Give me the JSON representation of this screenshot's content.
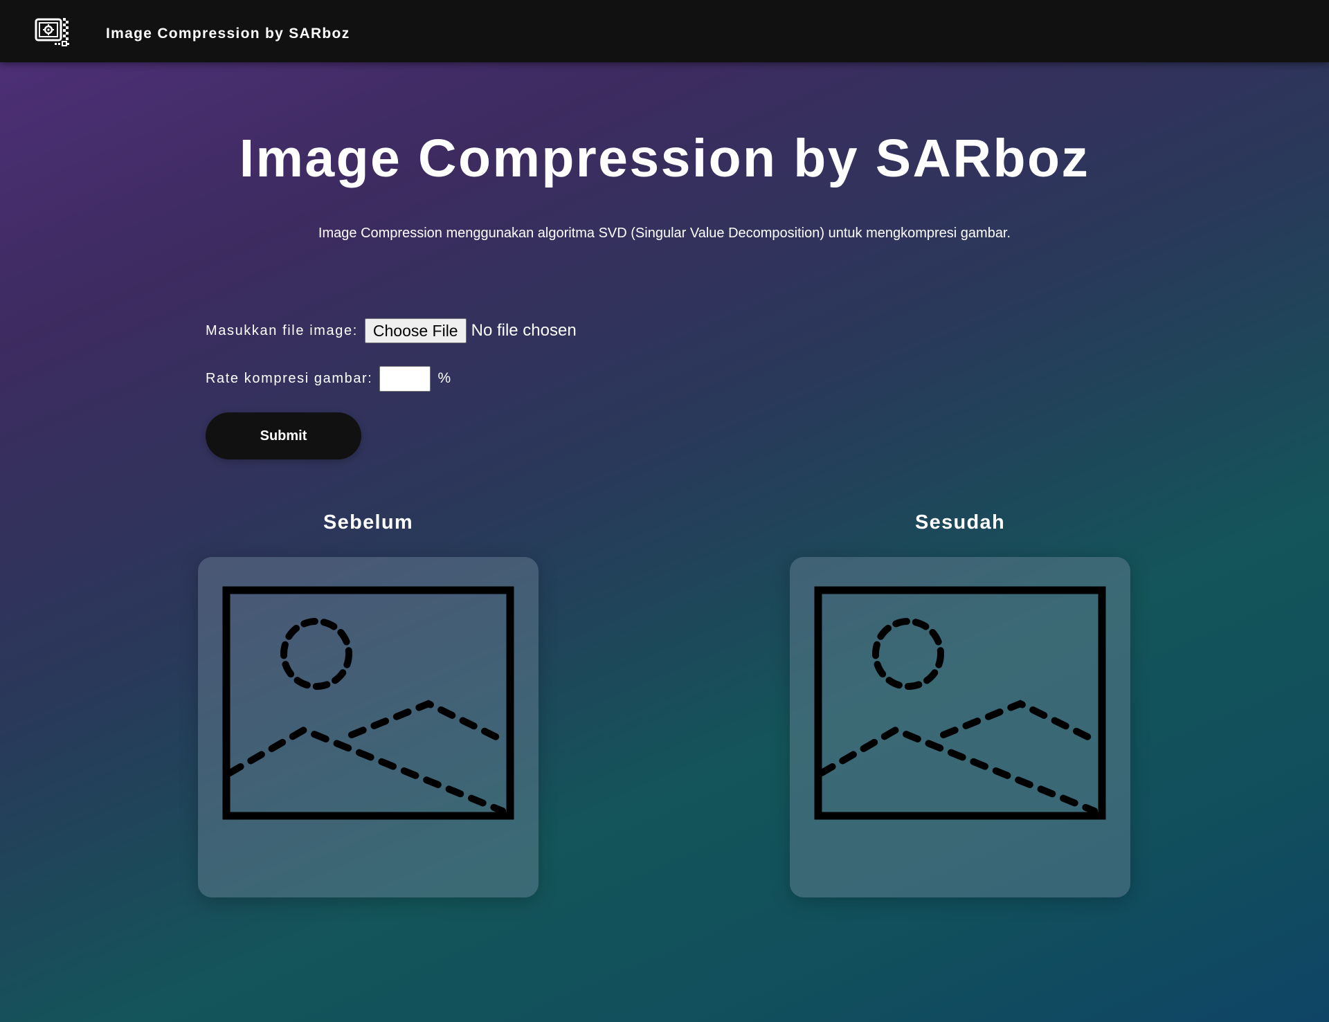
{
  "navbar": {
    "logo_icon": "compress-image-icon",
    "title": "Image Compression by SARboz"
  },
  "hero": {
    "title": "Image Compression by SARboz",
    "description": "Image Compression menggunakan algoritma SVD (Singular Value Decomposition) untuk mengkompresi gambar."
  },
  "form": {
    "file_label": "Masukkan file image:",
    "file_button": "Choose File",
    "file_status": "No file chosen",
    "rate_label": "Rate kompresi gambar:",
    "rate_value": "",
    "rate_unit": "%",
    "submit_label": "Submit"
  },
  "panels": {
    "before": {
      "heading": "Sebelum",
      "placeholder_icon": "image-placeholder-icon"
    },
    "after": {
      "heading": "Sesudah",
      "placeholder_icon": "image-placeholder-icon"
    }
  },
  "colors": {
    "navbar_bg": "#111111",
    "button_bg": "#111111",
    "text": "#ffffff",
    "gradient_start": "#50307a",
    "gradient_end": "#0f4466"
  }
}
